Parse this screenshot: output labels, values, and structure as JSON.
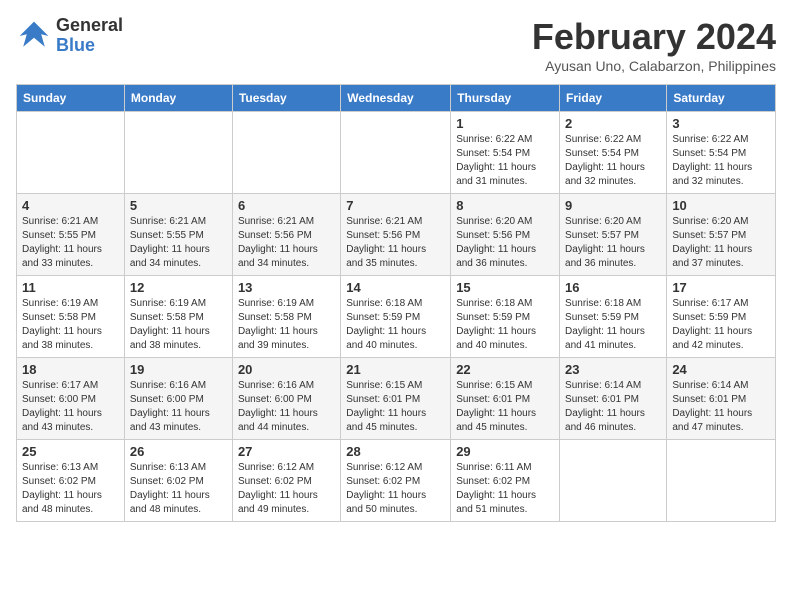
{
  "logo": {
    "line1": "General",
    "line2": "Blue"
  },
  "title": "February 2024",
  "location": "Ayusan Uno, Calabarzon, Philippines",
  "days_of_week": [
    "Sunday",
    "Monday",
    "Tuesday",
    "Wednesday",
    "Thursday",
    "Friday",
    "Saturday"
  ],
  "weeks": [
    [
      {
        "day": "",
        "content": ""
      },
      {
        "day": "",
        "content": ""
      },
      {
        "day": "",
        "content": ""
      },
      {
        "day": "",
        "content": ""
      },
      {
        "day": "1",
        "content": "Sunrise: 6:22 AM\nSunset: 5:54 PM\nDaylight: 11 hours\nand 31 minutes."
      },
      {
        "day": "2",
        "content": "Sunrise: 6:22 AM\nSunset: 5:54 PM\nDaylight: 11 hours\nand 32 minutes."
      },
      {
        "day": "3",
        "content": "Sunrise: 6:22 AM\nSunset: 5:54 PM\nDaylight: 11 hours\nand 32 minutes."
      }
    ],
    [
      {
        "day": "4",
        "content": "Sunrise: 6:21 AM\nSunset: 5:55 PM\nDaylight: 11 hours\nand 33 minutes."
      },
      {
        "day": "5",
        "content": "Sunrise: 6:21 AM\nSunset: 5:55 PM\nDaylight: 11 hours\nand 34 minutes."
      },
      {
        "day": "6",
        "content": "Sunrise: 6:21 AM\nSunset: 5:56 PM\nDaylight: 11 hours\nand 34 minutes."
      },
      {
        "day": "7",
        "content": "Sunrise: 6:21 AM\nSunset: 5:56 PM\nDaylight: 11 hours\nand 35 minutes."
      },
      {
        "day": "8",
        "content": "Sunrise: 6:20 AM\nSunset: 5:56 PM\nDaylight: 11 hours\nand 36 minutes."
      },
      {
        "day": "9",
        "content": "Sunrise: 6:20 AM\nSunset: 5:57 PM\nDaylight: 11 hours\nand 36 minutes."
      },
      {
        "day": "10",
        "content": "Sunrise: 6:20 AM\nSunset: 5:57 PM\nDaylight: 11 hours\nand 37 minutes."
      }
    ],
    [
      {
        "day": "11",
        "content": "Sunrise: 6:19 AM\nSunset: 5:58 PM\nDaylight: 11 hours\nand 38 minutes."
      },
      {
        "day": "12",
        "content": "Sunrise: 6:19 AM\nSunset: 5:58 PM\nDaylight: 11 hours\nand 38 minutes."
      },
      {
        "day": "13",
        "content": "Sunrise: 6:19 AM\nSunset: 5:58 PM\nDaylight: 11 hours\nand 39 minutes."
      },
      {
        "day": "14",
        "content": "Sunrise: 6:18 AM\nSunset: 5:59 PM\nDaylight: 11 hours\nand 40 minutes."
      },
      {
        "day": "15",
        "content": "Sunrise: 6:18 AM\nSunset: 5:59 PM\nDaylight: 11 hours\nand 40 minutes."
      },
      {
        "day": "16",
        "content": "Sunrise: 6:18 AM\nSunset: 5:59 PM\nDaylight: 11 hours\nand 41 minutes."
      },
      {
        "day": "17",
        "content": "Sunrise: 6:17 AM\nSunset: 5:59 PM\nDaylight: 11 hours\nand 42 minutes."
      }
    ],
    [
      {
        "day": "18",
        "content": "Sunrise: 6:17 AM\nSunset: 6:00 PM\nDaylight: 11 hours\nand 43 minutes."
      },
      {
        "day": "19",
        "content": "Sunrise: 6:16 AM\nSunset: 6:00 PM\nDaylight: 11 hours\nand 43 minutes."
      },
      {
        "day": "20",
        "content": "Sunrise: 6:16 AM\nSunset: 6:00 PM\nDaylight: 11 hours\nand 44 minutes."
      },
      {
        "day": "21",
        "content": "Sunrise: 6:15 AM\nSunset: 6:01 PM\nDaylight: 11 hours\nand 45 minutes."
      },
      {
        "day": "22",
        "content": "Sunrise: 6:15 AM\nSunset: 6:01 PM\nDaylight: 11 hours\nand 45 minutes."
      },
      {
        "day": "23",
        "content": "Sunrise: 6:14 AM\nSunset: 6:01 PM\nDaylight: 11 hours\nand 46 minutes."
      },
      {
        "day": "24",
        "content": "Sunrise: 6:14 AM\nSunset: 6:01 PM\nDaylight: 11 hours\nand 47 minutes."
      }
    ],
    [
      {
        "day": "25",
        "content": "Sunrise: 6:13 AM\nSunset: 6:02 PM\nDaylight: 11 hours\nand 48 minutes."
      },
      {
        "day": "26",
        "content": "Sunrise: 6:13 AM\nSunset: 6:02 PM\nDaylight: 11 hours\nand 48 minutes."
      },
      {
        "day": "27",
        "content": "Sunrise: 6:12 AM\nSunset: 6:02 PM\nDaylight: 11 hours\nand 49 minutes."
      },
      {
        "day": "28",
        "content": "Sunrise: 6:12 AM\nSunset: 6:02 PM\nDaylight: 11 hours\nand 50 minutes."
      },
      {
        "day": "29",
        "content": "Sunrise: 6:11 AM\nSunset: 6:02 PM\nDaylight: 11 hours\nand 51 minutes."
      },
      {
        "day": "",
        "content": ""
      },
      {
        "day": "",
        "content": ""
      }
    ]
  ]
}
